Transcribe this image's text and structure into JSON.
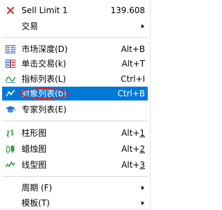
{
  "menu": {
    "header": {
      "label": "Sell Limit 1",
      "value": "139.608",
      "icon": "x-close-icon",
      "icon_color": "#e02b2b"
    },
    "trade": {
      "label": "交易",
      "submenu": true
    },
    "market_depth": {
      "label": "市场深度(D)",
      "shortcut": "Alt+B",
      "icon": "market-depth-icon"
    },
    "one_click_trading": {
      "label": "单击交易(k)",
      "shortcut": "Alt+T",
      "icon": "one-click-trading-icon"
    },
    "indicators_list": {
      "label": "指标列表(L)",
      "shortcut": "Ctrl+I",
      "icon": "indicators-icon"
    },
    "objects_list": {
      "label": "对象列表(b)",
      "shortcut": "Ctrl+B",
      "icon": "objects-list-icon",
      "selected": true
    },
    "experts_list": {
      "label": "专家列表(E)",
      "icon": "experts-icon"
    },
    "bar_chart": {
      "label": "柱形图",
      "shortcut_prefix": "Alt+",
      "shortcut_key": "1",
      "icon": "bar-chart-icon"
    },
    "candlesticks": {
      "label": "蜡烛图",
      "shortcut_prefix": "Alt+",
      "shortcut_key": "2",
      "icon": "candlestick-icon"
    },
    "line_chart": {
      "label": "线型图",
      "shortcut_prefix": "Alt+",
      "shortcut_key": "3",
      "icon": "line-chart-icon"
    },
    "periodicity": {
      "label": "周期 (F)",
      "submenu": true
    },
    "template": {
      "label": "模板(T)",
      "submenu": true
    }
  },
  "colors": {
    "selection": "#0078d7",
    "highlight_ellipse": "#e0262a",
    "icon_blue": "#2a6fc9",
    "icon_green": "#2a9d3a",
    "icon_red": "#d63a2a"
  }
}
